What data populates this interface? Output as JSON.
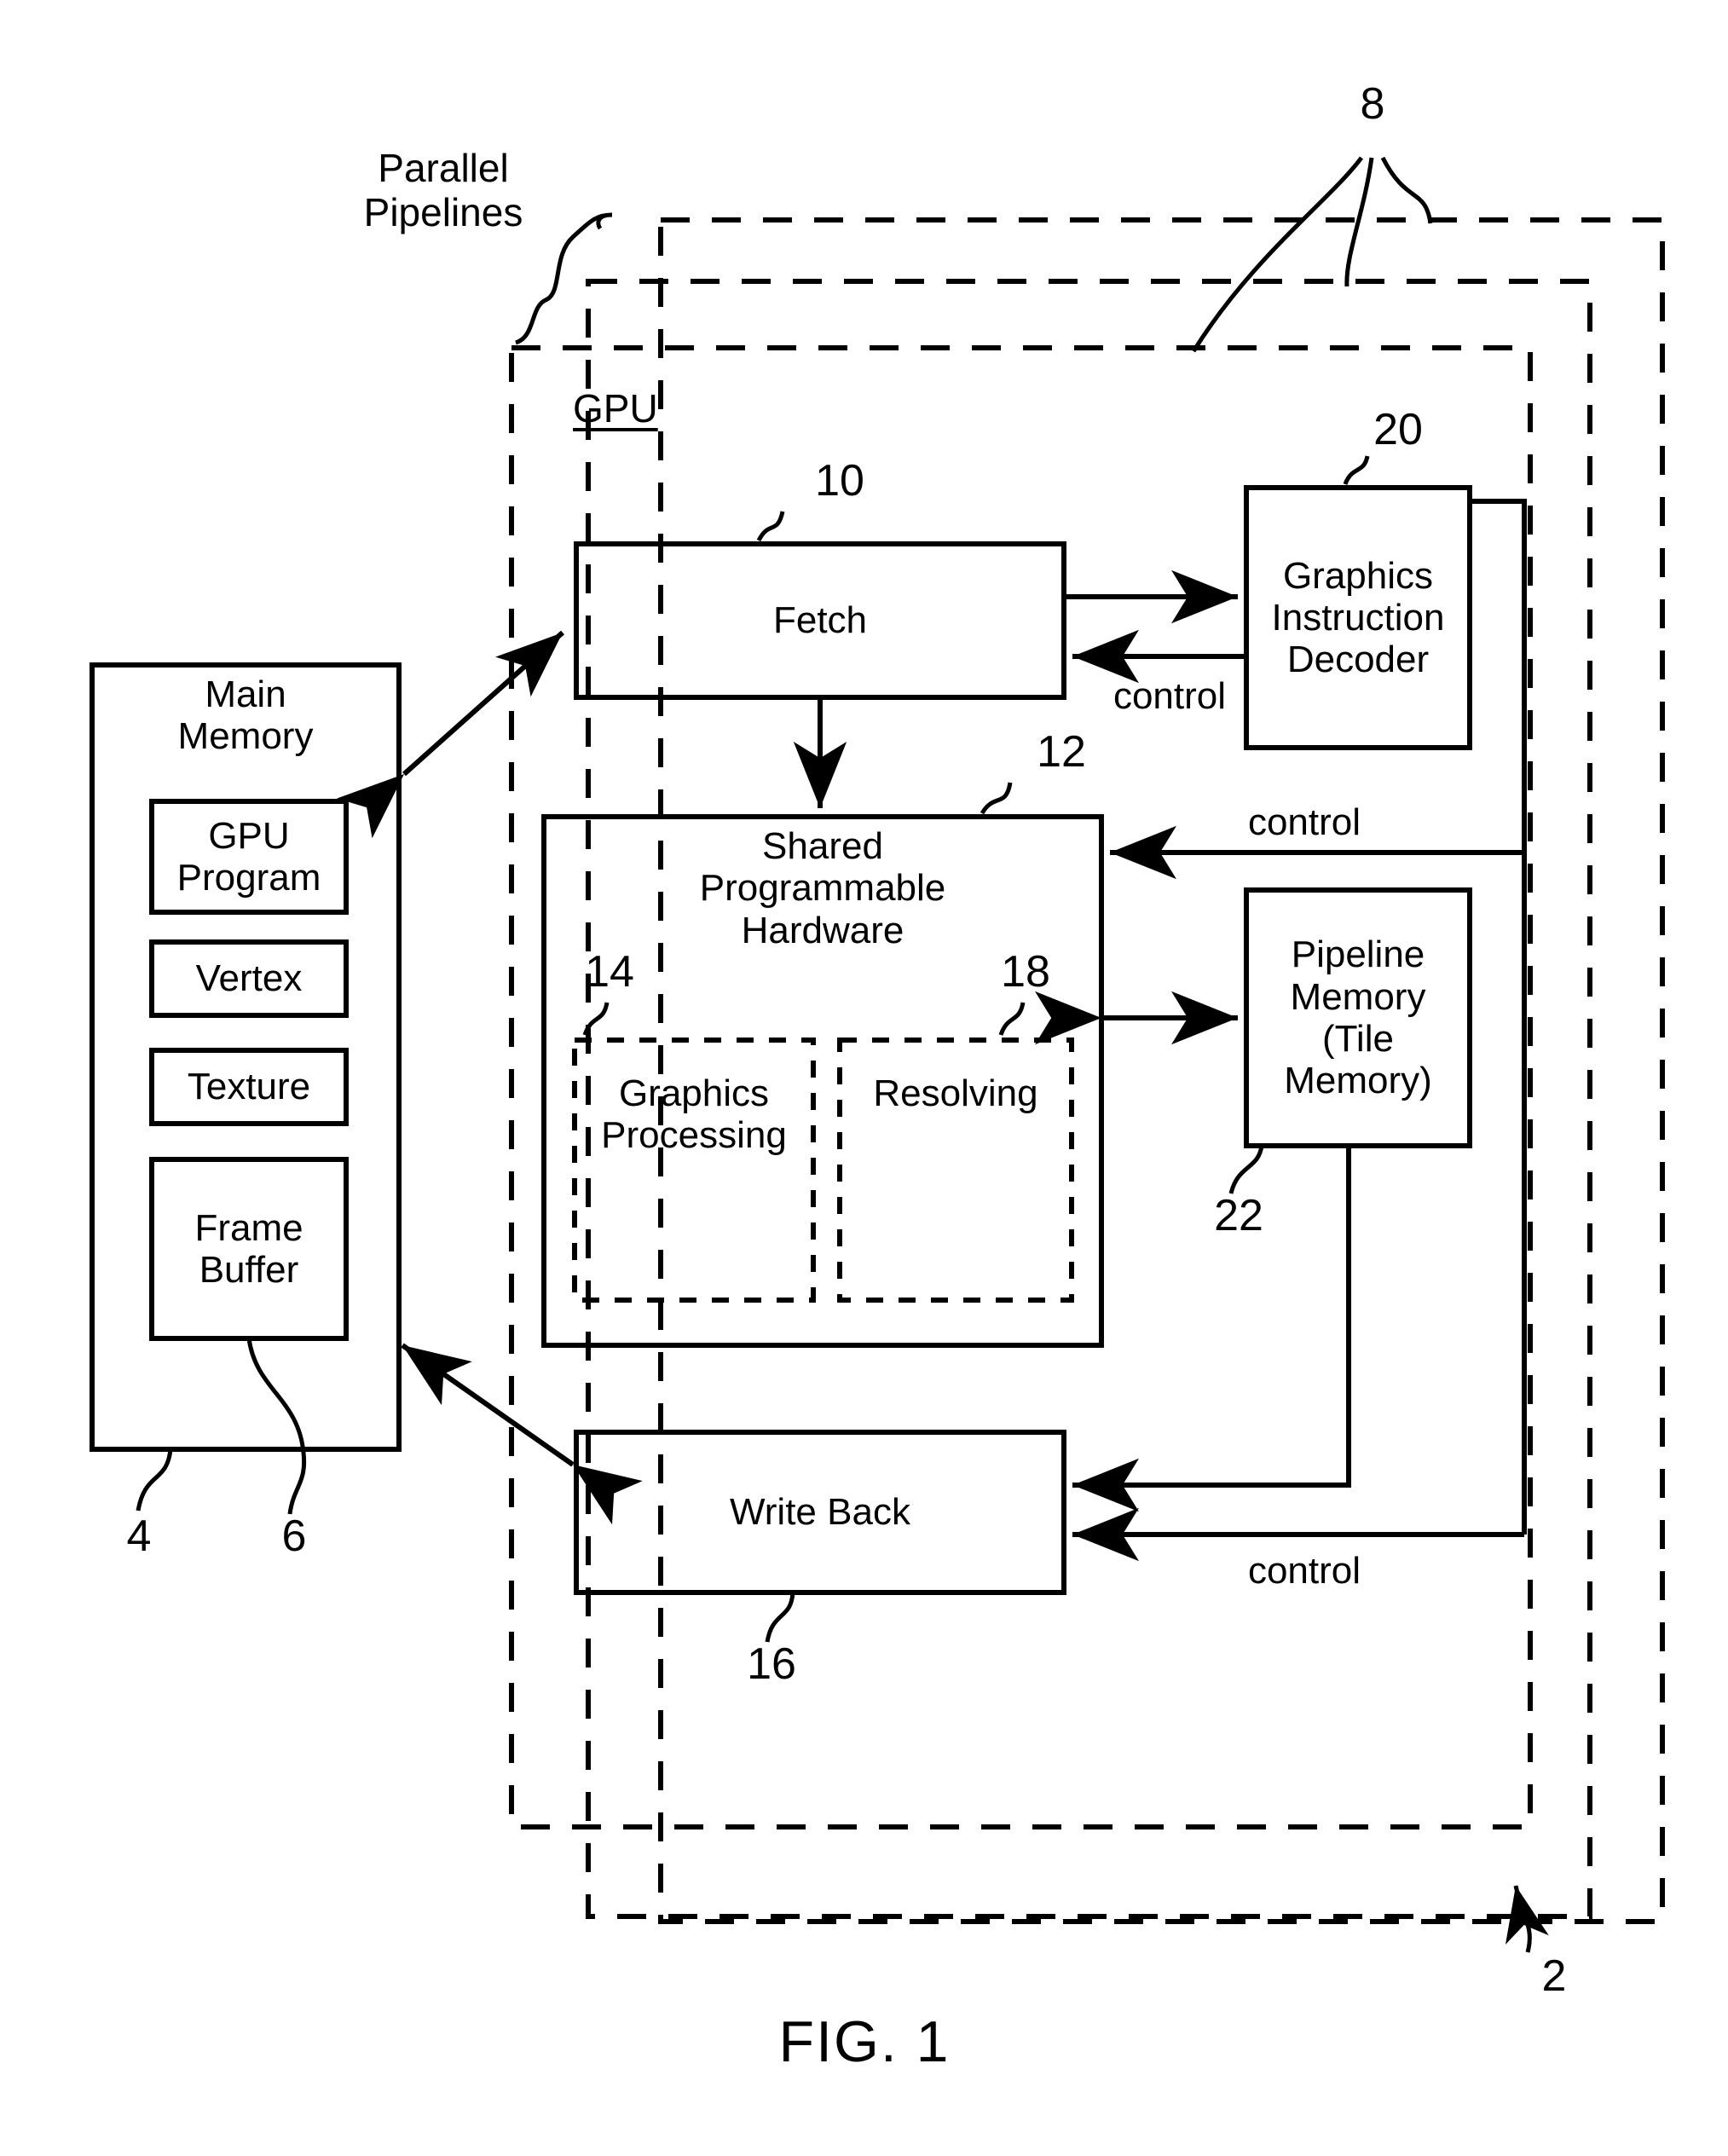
{
  "figure": {
    "caption": "FIG. 1",
    "system_ref": "2"
  },
  "annotations": {
    "parallel_pipelines_label": "Parallel\nPipelines",
    "pipelines_ref": "8",
    "gpu_tag": "GPU"
  },
  "memory": {
    "title": "Main\nMemory",
    "ref": "4",
    "blocks": [
      {
        "label": "GPU\nProgram"
      },
      {
        "label": "Vertex"
      },
      {
        "label": "Texture"
      },
      {
        "label": "Frame\nBuffer",
        "ref": "6"
      }
    ]
  },
  "gpu": {
    "blocks": [
      {
        "name": "fetch",
        "label": "Fetch",
        "ref": "10"
      },
      {
        "name": "shared-programmable-hardware",
        "label": "Shared\nProgrammable\nHardware",
        "ref": "12"
      },
      {
        "name": "graphics-processing",
        "label": "Graphics\nProcessing",
        "ref": "14"
      },
      {
        "name": "resolving",
        "label": "Resolving",
        "ref": "18"
      },
      {
        "name": "write-back",
        "label": "Write Back",
        "ref": "16"
      },
      {
        "name": "graphics-instruction-decoder",
        "label": "Graphics\nInstruction\nDecoder",
        "ref": "20"
      },
      {
        "name": "pipeline-memory",
        "label": "Pipeline\nMemory\n(Tile\nMemory)",
        "ref": "22"
      }
    ]
  },
  "signals": {
    "control_decoder_to_fetch": "control",
    "control_decoder_to_sph": "control",
    "control_decoder_to_writeback": "control"
  }
}
